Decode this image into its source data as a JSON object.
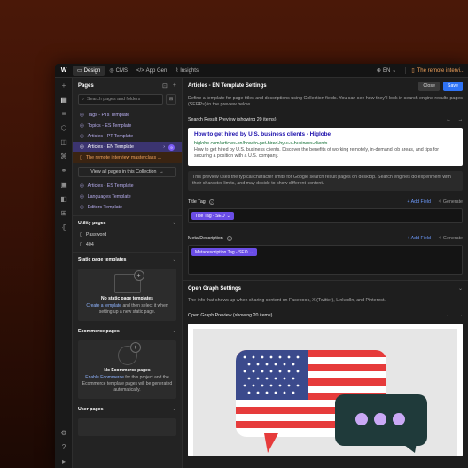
{
  "topbar": {
    "logo": "W",
    "tabs": [
      {
        "label": "Design",
        "icon": "design-icon"
      },
      {
        "label": "CMS",
        "icon": "cms-icon"
      },
      {
        "label": "App Gen",
        "icon": "code-icon"
      },
      {
        "label": "Insights",
        "icon": "chart-icon"
      }
    ],
    "language": "EN",
    "page_label": "The remote intervi..."
  },
  "pages_panel": {
    "title": "Pages",
    "search_placeholder": "Search pages and folders",
    "items": [
      {
        "label": "Tags - PTs Template"
      },
      {
        "label": "Topics - ES Template"
      },
      {
        "label": "Articles - PT Template"
      },
      {
        "label": "Articles - EN Template",
        "badge": "9"
      },
      {
        "label": "The remote interview masterclass ..."
      }
    ],
    "view_all": "View all pages in this Collection",
    "items2": [
      {
        "label": "Articles - ES Template"
      },
      {
        "label": "Languages Template"
      },
      {
        "label": "Editors Template"
      }
    ],
    "utility": {
      "title": "Utility pages",
      "items": [
        {
          "label": "Password"
        },
        {
          "label": "404"
        }
      ]
    },
    "static": {
      "title": "Static page templates",
      "empty_title": "No static page templates",
      "empty_link": "Create a template",
      "empty_text": "and then select it when setting up a new static page."
    },
    "ecommerce": {
      "title": "Ecommerce pages",
      "empty_title": "No Ecommerce pages",
      "empty_link": "Enable Ecommerce",
      "empty_text": "for this project and the Ecommerce template pages will be generated automatically."
    },
    "user": {
      "title": "User pages"
    }
  },
  "settings": {
    "title": "Articles - EN Template Settings",
    "close": "Close",
    "save": "Save",
    "description": "Define a template for page titles and descriptions using Collection fields. You can see how they'll look in search engine results pages (SERPs) in the preview below.",
    "serp_heading": "Search Result Preview (showing 20 items)",
    "serp": {
      "title": "How to get hired by U.S. business clients - Higlobe",
      "url": "higlobe.com/articles-en/how-to-get-hired-by-u-s-business-clients",
      "desc": "How to get hired by U.S. business clients. Discover the benefits of working remotely, in-demand job areas, and tips for securing a position with a U.S. company."
    },
    "info": "This preview uses the typical character limits for Google search result pages on desktop. Search engines do experiment with their character limits, and may decide to show different content.",
    "title_tag": {
      "label": "Title Tag",
      "tag": "Title Tag - SEO"
    },
    "meta_desc": {
      "label": "Meta Description",
      "tag": "Metadescription Tag - SEO"
    },
    "add_field": "+ Add Field",
    "generate": "Generate",
    "og_title": "Open Graph Settings",
    "og_desc": "The info that shows up when sharing content on Facebook, X (Twitter), LinkedIn, and Pinterest.",
    "og_preview_heading": "Open Graph Preview (showing 20 items)"
  }
}
